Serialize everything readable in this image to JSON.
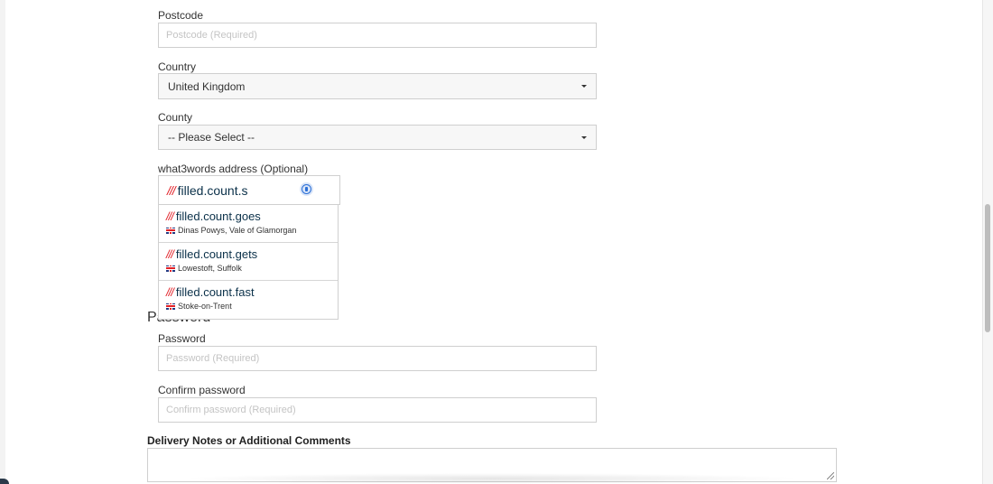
{
  "form": {
    "postcode": {
      "label": "Postcode",
      "placeholder": "Postcode (Required)"
    },
    "country": {
      "label": "Country",
      "value": "United Kingdom"
    },
    "county": {
      "label": "County",
      "value": "-- Please Select --"
    },
    "w3w": {
      "label": "what3words address (Optional)",
      "prefix": "///",
      "value": "filled.count.s",
      "suggestions": [
        {
          "prefix": "///",
          "words": "filled.count.goes",
          "location": "Dinas Powys, Vale of Glamorgan"
        },
        {
          "prefix": "///",
          "words": "filled.count.gets",
          "location": "Lowestoft, Suffolk"
        },
        {
          "prefix": "///",
          "words": "filled.count.fast",
          "location": "Stoke-on-Trent"
        }
      ]
    },
    "password_section": {
      "heading": "Password"
    },
    "password": {
      "label": "Password",
      "placeholder": "Password (Required)"
    },
    "confirm_password": {
      "label": "Confirm password",
      "placeholder": "Confirm password (Required)"
    },
    "delivery_notes": {
      "label": "Delivery Notes or Additional Comments"
    }
  },
  "icons": {
    "info": "info-icon",
    "flag": "uk-flag-icon",
    "caret": "caret-down-icon",
    "resize": "resize-handle-icon"
  },
  "colors": {
    "w3w_red": "#e11f26",
    "w3w_navy": "#0a3049",
    "info_blue": "#2a6fd6"
  }
}
